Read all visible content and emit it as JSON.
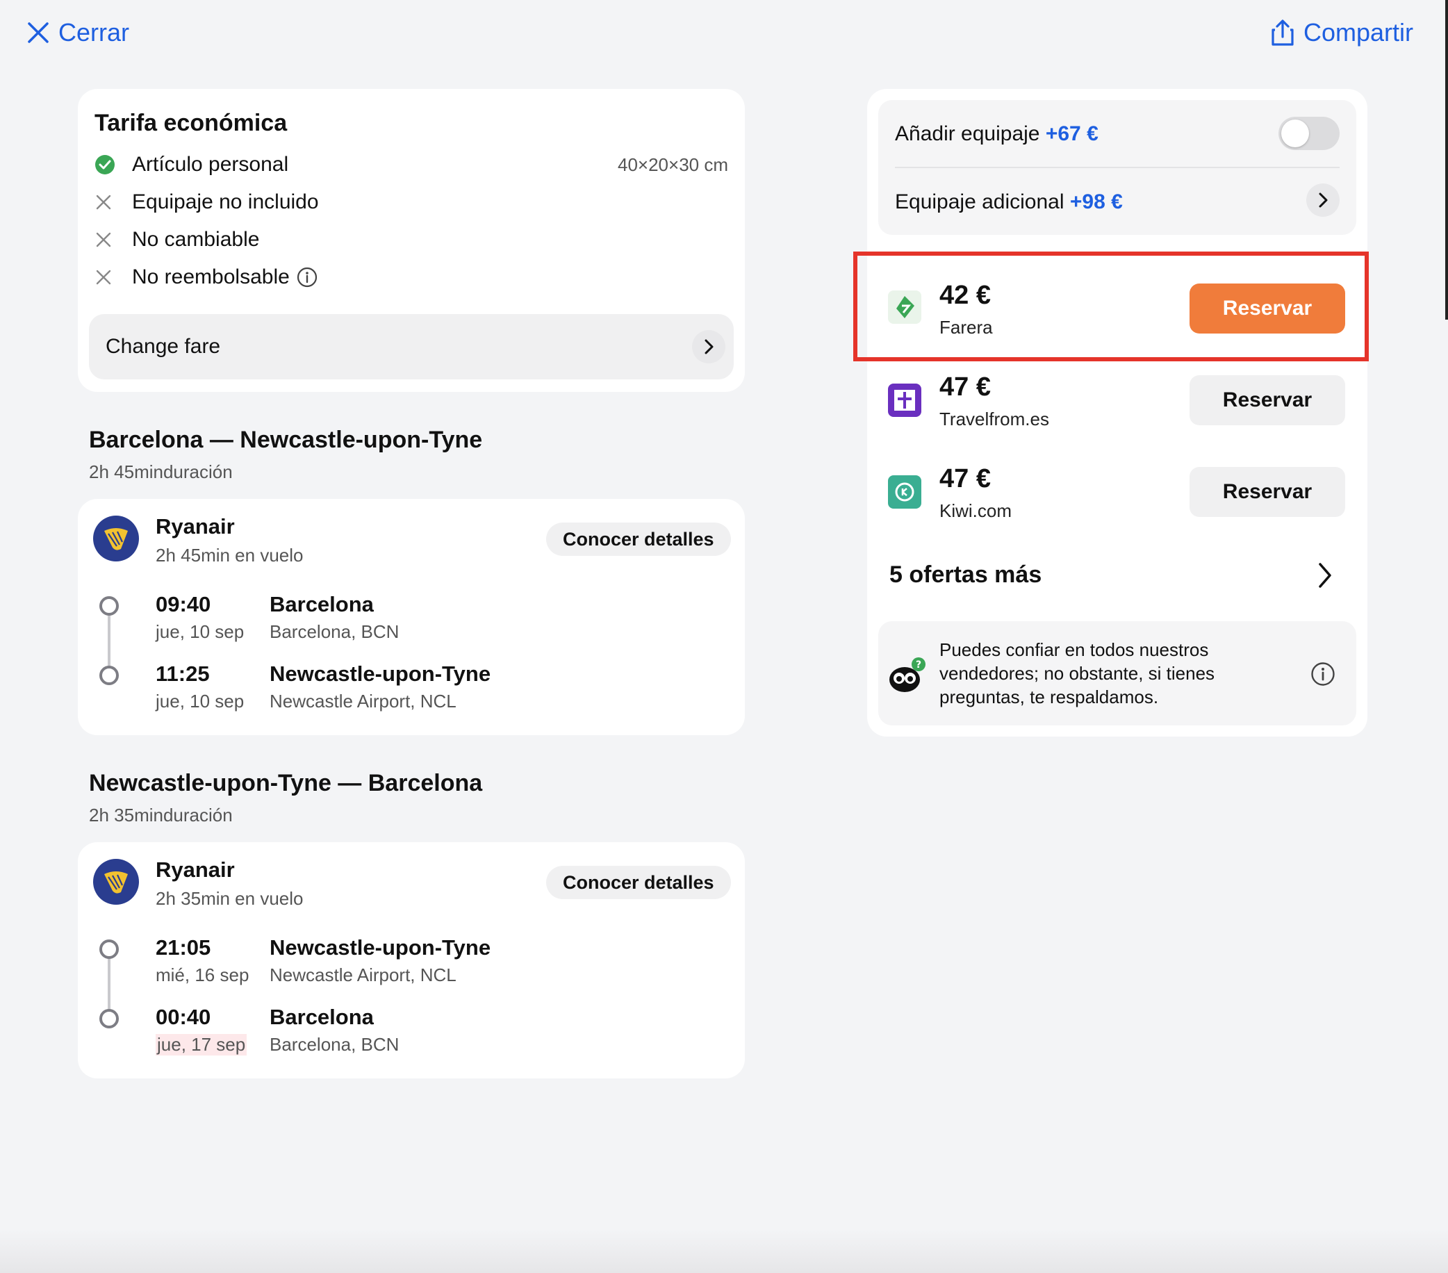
{
  "topbar": {
    "close_label": "Cerrar",
    "share_label": "Compartir"
  },
  "fare": {
    "title": "Tarifa económica",
    "items": [
      {
        "label": "Artículo personal",
        "included": true,
        "detail": "40×20×30 cm"
      },
      {
        "label": "Equipaje no incluido",
        "included": false
      },
      {
        "label": "No cambiable",
        "included": false
      },
      {
        "label": "No reembolsable",
        "included": false
      }
    ],
    "change_fare_label": "Change fare"
  },
  "segments": [
    {
      "title": "Barcelona — Newcastle-upon-Tyne",
      "duration": "2h 45minduración",
      "airline": "Ryanair",
      "flight_time": "2h 45min en vuelo",
      "details_label": "Conocer detalles",
      "departure": {
        "time": "09:40",
        "date": "jue, 10 sep",
        "city": "Barcelona",
        "airport": "Barcelona, BCN"
      },
      "arrival": {
        "time": "11:25",
        "date": "jue, 10 sep",
        "city": "Newcastle-upon-Tyne",
        "airport": "Newcastle Airport, NCL"
      }
    },
    {
      "title": "Newcastle-upon-Tyne — Barcelona",
      "duration": "2h 35minduración",
      "airline": "Ryanair",
      "flight_time": "2h 35min en vuelo",
      "details_label": "Conocer detalles",
      "departure": {
        "time": "21:05",
        "date": "mié, 16 sep",
        "city": "Newcastle-upon-Tyne",
        "airport": "Newcastle Airport, NCL"
      },
      "arrival": {
        "time": "00:40",
        "date": "jue, 17 sep",
        "city": "Barcelona",
        "airport": "Barcelona, BCN"
      }
    }
  ],
  "baggage": {
    "add_label": "Añadir equipaje",
    "add_price": "+67 €",
    "extra_label": "Equipaje adicional",
    "extra_price": "+98 €"
  },
  "offers": [
    {
      "price": "42 €",
      "vendor": "Farera",
      "button": "Reservar",
      "highlighted": true,
      "logo": "farera-logo-icon"
    },
    {
      "price": "47 €",
      "vendor": "Travelfrom.es",
      "button": "Reservar",
      "highlighted": false,
      "logo": "travelfrom-logo-icon"
    },
    {
      "price": "47 €",
      "vendor": "Kiwi.com",
      "button": "Reservar",
      "highlighted": false,
      "logo": "kiwi-logo-icon"
    }
  ],
  "more_offers_label": "5 ofertas más",
  "trust_message": "Puedes confiar en todos nuestros vendedores; no obstante, si tienes preguntas, te respaldamos.",
  "colors": {
    "accent": "#1e5fe0",
    "reserve_primary": "#f07c3b",
    "highlight_border": "#e5342a",
    "check": "#3aa655"
  }
}
